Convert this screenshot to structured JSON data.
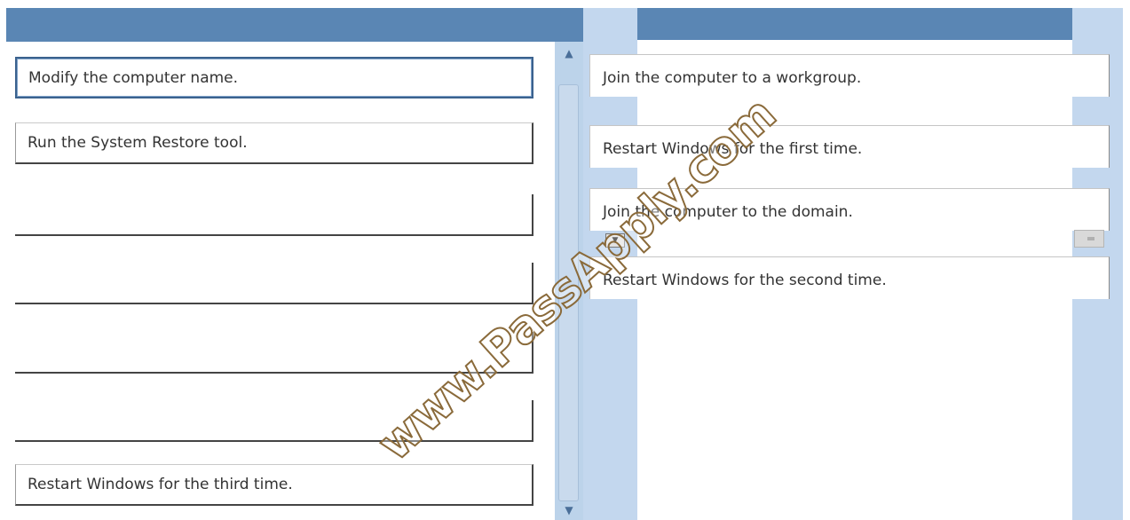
{
  "left_slots": [
    {
      "label": "Modify the computer name."
    },
    {
      "label": "Run the System Restore tool."
    },
    {
      "label": ""
    },
    {
      "label": ""
    },
    {
      "label": ""
    },
    {
      "label": ""
    },
    {
      "label": "Restart Windows for the third time."
    }
  ],
  "right_options": [
    {
      "label": "Join the computer to a workgroup."
    },
    {
      "label": "Restart Windows for the first time."
    },
    {
      "label": "Join the computer to the domain."
    },
    {
      "label": "Restart Windows for the second time."
    }
  ],
  "scrollbar": {
    "up_arrow": "▲",
    "down_arrow": "▼"
  },
  "dropdown_glyph": "▼",
  "watermark": "www.PassApply.com",
  "colors": {
    "header": "#5a86b4",
    "gap": "#c3d7ee",
    "selected_border": "#3b628e"
  }
}
